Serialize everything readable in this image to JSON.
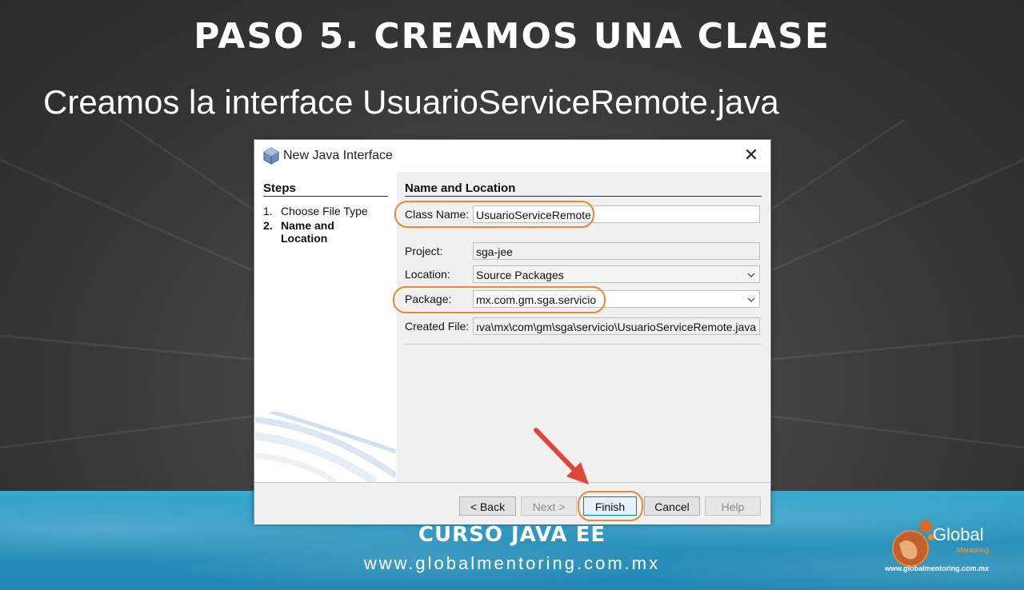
{
  "slide": {
    "title": "PASO 5. CREAMOS UNA CLASE",
    "subtitle": "Creamos la interface UsuarioServiceRemote.java",
    "footer_course": "CURSO JAVA EE",
    "footer_url": "www.globalmentoring.com.mx",
    "logo_text": "Global",
    "logo_sub": "Mentoring",
    "logo_url": "www.globalmentoring.com.mx"
  },
  "dialog": {
    "title": "New Java Interface",
    "title_icon": "java-interface-icon",
    "close_label": "✕",
    "steps": {
      "title": "Steps",
      "items": [
        {
          "num": "1.",
          "label": "Choose File Type",
          "current": false
        },
        {
          "num": "2.",
          "label": "Name and Location",
          "current": true
        }
      ]
    },
    "section_title": "Name and Location",
    "form": {
      "class_name_label": "Class Name:",
      "class_name_value": "UsuarioServiceRemote",
      "project_label": "Project:",
      "project_value": "sga-jee",
      "location_label": "Location:",
      "location_value": "Source Packages",
      "package_label": "Package:",
      "package_value": "mx.com.gm.sga.servicio",
      "created_file_label": "Created File:",
      "created_file_value": "ıva\\mx\\com\\gm\\sga\\servicio\\UsuarioServiceRemote.java"
    },
    "buttons": {
      "back": "< Back",
      "next": "Next >",
      "finish": "Finish",
      "cancel": "Cancel",
      "help": "Help"
    }
  },
  "colors": {
    "highlight": "#e88a2e",
    "arrow": "#e0453a",
    "band": "#2a93bd"
  }
}
